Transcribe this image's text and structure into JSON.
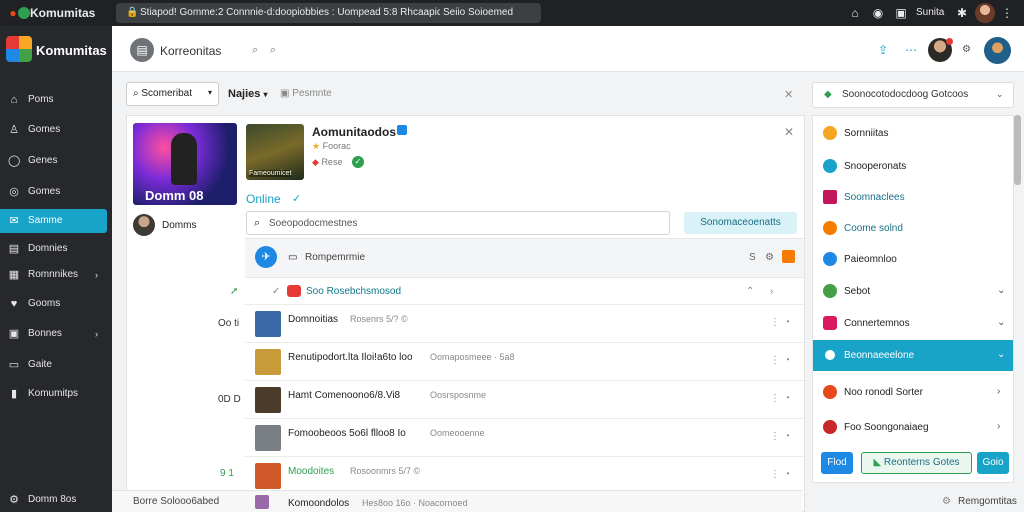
{
  "browser": {
    "app_title": "Komumitas",
    "url_text": "Stiapod! Gomme:2 Connnie-d:doopiobbies : Uompead 5:8 Rhcaapiq",
    "url_right": "Seiio Soioemed",
    "right_label": "Sunita"
  },
  "sidebar": {
    "brand": "Komumitas",
    "items": [
      {
        "label": "Poms",
        "icon": "home-icon",
        "glyph": "⌂"
      },
      {
        "label": "Gomes",
        "icon": "people-icon",
        "glyph": "⛹"
      },
      {
        "label": "Genes",
        "icon": "circle-icon",
        "glyph": "◯"
      },
      {
        "label": "Gomes",
        "icon": "globe-icon",
        "glyph": "◎"
      },
      {
        "label": "Samme",
        "icon": "chat-icon",
        "glyph": "✉"
      },
      {
        "label": "Domnies",
        "icon": "grid-icon",
        "glyph": "▤"
      },
      {
        "label": "Romnnikes",
        "icon": "list-icon",
        "glyph": "▦"
      },
      {
        "label": "Gooms",
        "icon": "heart-icon",
        "glyph": "♥"
      },
      {
        "label": "Bonnes",
        "icon": "doc-icon",
        "glyph": "▣"
      },
      {
        "label": "Gaite",
        "icon": "book-icon",
        "glyph": "▭"
      },
      {
        "label": "Komumitps",
        "icon": "user-icon",
        "glyph": "▮"
      }
    ],
    "footer": "Domm 8os"
  },
  "header": {
    "title": "Korreonitas",
    "search_glyph": "⌕"
  },
  "filter": {
    "dropdown_label": "Scomeribat",
    "tab_label": "Najies",
    "extra_label": "Pesmnte"
  },
  "game": {
    "cover_caption": "Domm 08",
    "username": "Domms",
    "thumb_caption": "Fameoumicet",
    "title": "Aomunitaodos",
    "meta1": "Foorac",
    "meta2": "Rese",
    "status": "Online",
    "search_placeholder": "Soeopodocmestnes",
    "search_button": "Sonomaceoenatts",
    "list_header": "Rompemrmie",
    "list_header_right": "S",
    "filter_row": "Soo Rosebchsmosod",
    "rows": [
      {
        "title": "Domnoitias",
        "tail": "Rosenrs 5/? ©",
        "side": "Oo ti",
        "color": "#3a6aa8"
      },
      {
        "title": "Renutipodort.lta Iloi!a6to loo",
        "tail": "Oomaposmeee · 5a8",
        "side": "",
        "color": "#c79a3a"
      },
      {
        "title": "Hamt Comenoono6/8.Vi8",
        "tail": "Oosrsposnme",
        "side": "0D D",
        "color": "#4b3b2a"
      },
      {
        "title": "Fomoobeoos 5o6l flloo8 Io",
        "tail": "Oomeooenne",
        "side": "",
        "color": "#7a7f86"
      },
      {
        "title": "Moodoites",
        "tail": "Rosoonmrs 5/7 ©",
        "side": "9 1",
        "color": "#d05a2a"
      },
      {
        "title": "Komoondolos",
        "tail": "Hes8oo 16o · Noacornoed",
        "side": "",
        "color": "#9a6aa8"
      }
    ],
    "footer_label": "Borre Solooo6abed"
  },
  "right": {
    "dropdown_label": "Soonocotodocdoog Gotcoos",
    "items": [
      {
        "label": "Sornniitas",
        "color": "#f5a623",
        "chevron": ""
      },
      {
        "label": "Snooperonats",
        "color": "#18a3c8",
        "chevron": ""
      },
      {
        "label": "Soomnaclees",
        "color": "#c2185b",
        "chevron": ""
      },
      {
        "label": "Coome solnd",
        "color": "#f57c00",
        "chevron": ""
      },
      {
        "label": "Paieomnloo",
        "color": "#1e88e5",
        "chevron": ""
      },
      {
        "label": "Sebot",
        "color": "#43a047",
        "chevron": "⌄"
      },
      {
        "label": "Connertemnos",
        "color": "#d81b60",
        "chevron": "⌄"
      },
      {
        "label": "Beonnaeeelone",
        "color": "#18a3c8",
        "chevron": "⌄"
      },
      {
        "label": "Noo ronodl Sorter",
        "color": "#e64a19",
        "chevron": "›"
      },
      {
        "label": "Foo Soongonaiaeg",
        "color": "#c62828",
        "chevron": "›"
      }
    ],
    "btn1": "Flod",
    "btn2": "Reonterns Gotes",
    "btn3": "Goio",
    "footer": "Remgomtitas"
  }
}
